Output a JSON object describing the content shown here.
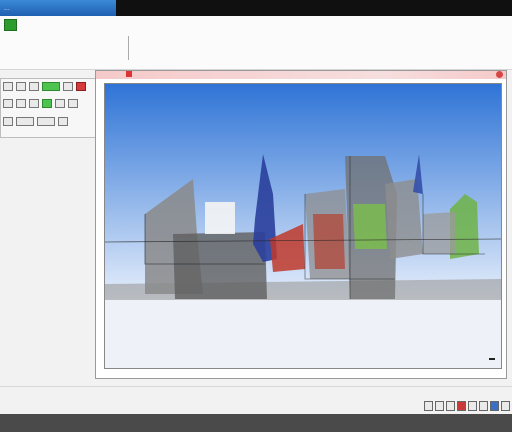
{
  "window": {
    "title": "...",
    "dark_items": [
      "",
      "",
      "",
      "",
      ""
    ]
  },
  "ribbon": {
    "tabs": [
      "",
      "",
      "",
      ""
    ]
  },
  "menu": {
    "row1": [
      "",
      "",
      "",
      "",
      "",
      ""
    ],
    "row2": [
      "",
      "",
      "",
      "",
      ""
    ]
  },
  "tools": {
    "row1": [
      "",
      "",
      "",
      "",
      "",
      ""
    ],
    "row2": [
      "",
      "",
      "",
      "",
      "",
      ""
    ],
    "row3": [
      "",
      "",
      "",
      ""
    ]
  },
  "viewport": {
    "sky_top": "#2f74d6",
    "sky_bottom": "#e5eefb",
    "ground": "#eef2f8"
  },
  "status": {
    "icons": [
      "",
      "",
      "",
      "",
      "",
      "",
      "",
      ""
    ]
  }
}
